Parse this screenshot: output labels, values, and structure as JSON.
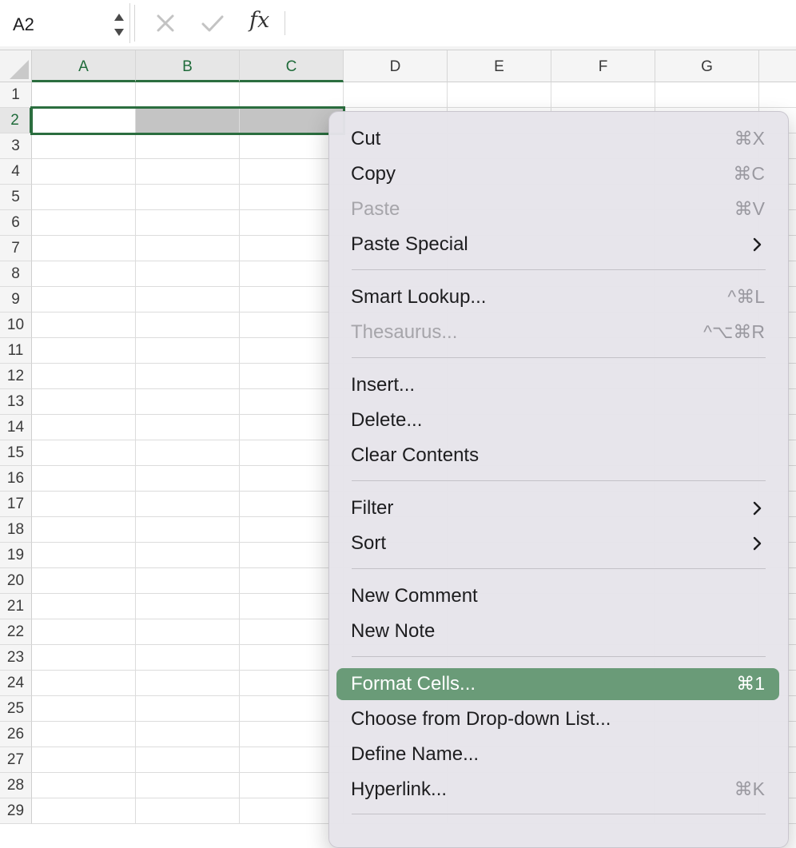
{
  "formula_bar": {
    "name_box": "A2",
    "fx_label": "fx",
    "formula": ""
  },
  "columns": [
    "A",
    "B",
    "C",
    "D",
    "E",
    "F",
    "G"
  ],
  "rows": [
    "1",
    "2",
    "3",
    "4",
    "5",
    "6",
    "7",
    "8",
    "9",
    "10",
    "11",
    "12",
    "13",
    "14",
    "15",
    "16",
    "17",
    "18",
    "19",
    "20",
    "21",
    "22",
    "23",
    "24",
    "25",
    "26",
    "27",
    "28",
    "29"
  ],
  "selection": {
    "active_cell": "A2",
    "range": "A2:C2",
    "selected_columns": [
      "A",
      "B",
      "C"
    ],
    "selected_row": "2"
  },
  "context_menu": {
    "items": [
      {
        "label": "Cut",
        "shortcut": "⌘X",
        "disabled": false,
        "submenu": false
      },
      {
        "label": "Copy",
        "shortcut": "⌘C",
        "disabled": false,
        "submenu": false
      },
      {
        "label": "Paste",
        "shortcut": "⌘V",
        "disabled": true,
        "submenu": false
      },
      {
        "label": "Paste Special",
        "shortcut": "",
        "disabled": false,
        "submenu": true
      },
      {
        "label": "Smart Lookup...",
        "shortcut": "^⌘L",
        "disabled": false,
        "submenu": false
      },
      {
        "label": "Thesaurus...",
        "shortcut": "^⌥⌘R",
        "disabled": true,
        "submenu": false
      },
      {
        "label": "Insert...",
        "shortcut": "",
        "disabled": false,
        "submenu": false
      },
      {
        "label": "Delete...",
        "shortcut": "",
        "disabled": false,
        "submenu": false
      },
      {
        "label": "Clear Contents",
        "shortcut": "",
        "disabled": false,
        "submenu": false
      },
      {
        "label": "Filter",
        "shortcut": "",
        "disabled": false,
        "submenu": true
      },
      {
        "label": "Sort",
        "shortcut": "",
        "disabled": false,
        "submenu": true
      },
      {
        "label": "New Comment",
        "shortcut": "",
        "disabled": false,
        "submenu": false
      },
      {
        "label": "New Note",
        "shortcut": "",
        "disabled": false,
        "submenu": false
      },
      {
        "label": "Format Cells...",
        "shortcut": "⌘1",
        "disabled": false,
        "submenu": false,
        "highlighted": true
      },
      {
        "label": "Choose from Drop-down List...",
        "shortcut": "",
        "disabled": false,
        "submenu": false
      },
      {
        "label": "Define Name...",
        "shortcut": "",
        "disabled": false,
        "submenu": false
      },
      {
        "label": "Hyperlink...",
        "shortcut": "⌘K",
        "disabled": false,
        "submenu": false
      }
    ]
  },
  "colors": {
    "selection_green": "#2b6e3f",
    "menu_highlight": "#6a9b78"
  }
}
